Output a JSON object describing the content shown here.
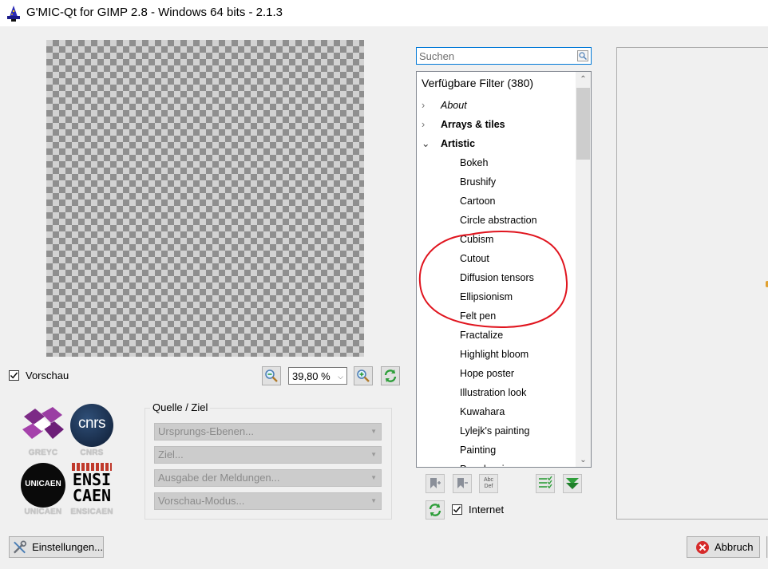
{
  "window": {
    "title": "G'MIC-Qt for GIMP 2.8 - Windows 64 bits - 2.1.3"
  },
  "preview": {
    "preview_checkbox_label": "Vorschau",
    "preview_checked": true,
    "zoom_value": "39,80 %"
  },
  "logos": {
    "greyc": "GREYC",
    "cnrs": "CNRS",
    "cnrs_mark": "cnrs",
    "unicaen": "UNICAEN",
    "unicaen_mark": "UNICAEN",
    "ensicaen": "ENSICAEN",
    "ensicaen_mark_top": "ENSI",
    "ensicaen_mark_bottom": "CAEN"
  },
  "io_group": {
    "title": "Quelle  / Ziel",
    "input_layers": "Ursprungs-Ebenen...",
    "output_mode": "Ziel...",
    "output_messages": "Ausgabe der Meldungen...",
    "preview_mode": "Vorschau-Modus..."
  },
  "filters": {
    "search_placeholder": "Suchen",
    "header": "Verfügbare Filter (380)",
    "categories": [
      {
        "label": "About",
        "expanded": false,
        "style": "italic"
      },
      {
        "label": "Arrays & tiles",
        "expanded": false,
        "style": "bold"
      },
      {
        "label": "Artistic",
        "expanded": true,
        "style": "bold"
      }
    ],
    "items": [
      "Bokeh",
      "Brushify",
      "Cartoon",
      "Circle abstraction",
      "Cubism",
      "Cutout",
      "Diffusion tensors",
      "Ellipsionism",
      "Felt pen",
      "Fractalize",
      "Highlight bloom",
      "Hope poster",
      "Illustration look",
      "Kuwahara",
      "Lylejk's painting",
      "Painting",
      "Pen drawing"
    ],
    "internet_label": "Internet",
    "internet_checked": true,
    "abc_icon_top": "Abc",
    "abc_icon_bottom": "Def"
  },
  "annotation": {
    "color": "#e0141e",
    "highlighted_items": [
      "Cubism",
      "Cutout",
      "Diffusion tensors",
      "Ellipsionism",
      "Felt pen"
    ]
  },
  "buttons": {
    "settings": "Einstellungen...",
    "cancel": "Abbruch"
  },
  "colors": {
    "accent": "#0078d7",
    "window_bg": "#f0f0f0",
    "green_icon": "#2e9e3a",
    "cancel_red": "#d62a2a"
  }
}
